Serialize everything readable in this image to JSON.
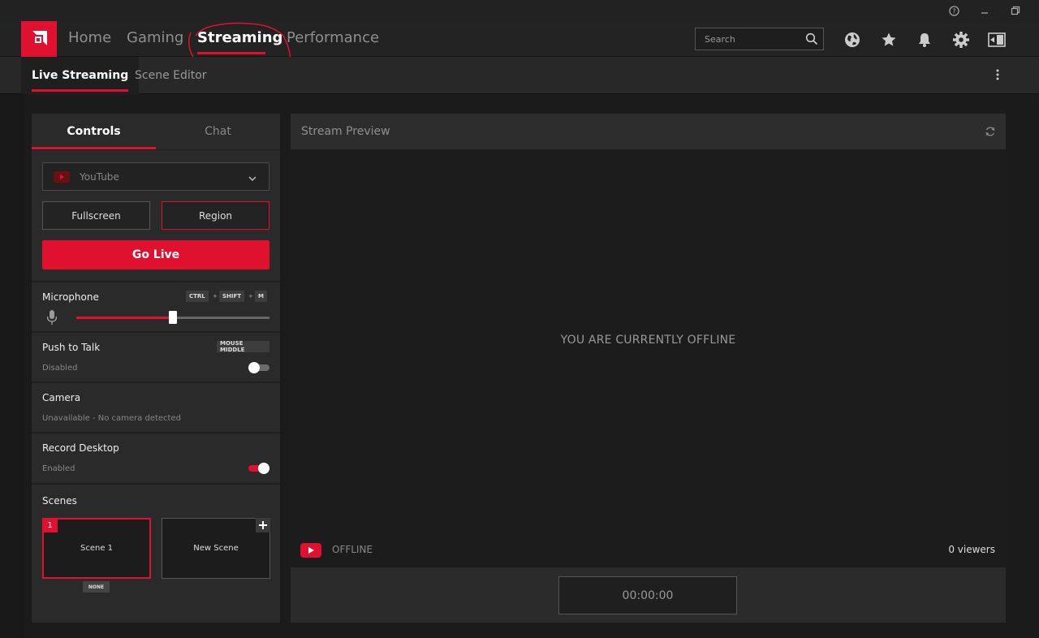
{
  "titlebar": {
    "help_icon": "help-icon",
    "minimize_icon": "minimize-icon",
    "restore_icon": "restore-icon"
  },
  "nav": {
    "items": [
      {
        "label": "Home"
      },
      {
        "label": "Gaming"
      },
      {
        "label": "Streaming",
        "active": true
      },
      {
        "label": "Performance"
      }
    ],
    "search_placeholder": "Search",
    "icons": [
      "globe-icon",
      "star-icon",
      "bell-icon",
      "gear-icon",
      "sidebar-toggle-icon"
    ]
  },
  "subnav": {
    "tabs": [
      {
        "label": "Live Streaming",
        "active": true
      },
      {
        "label": "Scene Editor"
      }
    ]
  },
  "controls": {
    "tabs": [
      {
        "label": "Controls",
        "active": true
      },
      {
        "label": "Chat"
      }
    ],
    "platform": "YouTube",
    "capture_modes": [
      {
        "label": "Fullscreen"
      },
      {
        "label": "Region",
        "selected": true
      }
    ],
    "go_live": "Go Live",
    "microphone": {
      "label": "Microphone",
      "hotkeys": [
        "CTRL",
        "SHIFT",
        "M"
      ],
      "hotkey_sep": "+",
      "level": 0.5
    },
    "push_to_talk": {
      "label": "Push to Talk",
      "hotkey": "MOUSE MIDDLE",
      "status": "Disabled",
      "enabled": false
    },
    "camera": {
      "label": "Camera",
      "status": "Unavailable - No camera detected"
    },
    "record_desktop": {
      "label": "Record Desktop",
      "status": "Enabled",
      "enabled": true
    },
    "scenes": {
      "label": "Scenes",
      "items": [
        {
          "number": "1",
          "name": "Scene 1",
          "badge": "NONE"
        },
        {
          "name": "New Scene"
        }
      ]
    }
  },
  "preview": {
    "title": "Stream Preview",
    "message": "YOU ARE CURRENTLY OFFLINE",
    "status": "OFFLINE",
    "viewers": "0 viewers",
    "timer": "00:00:00"
  },
  "colors": {
    "accent": "#e0102f",
    "background": "#1b1b1b",
    "panel": "#2a2a2a"
  }
}
